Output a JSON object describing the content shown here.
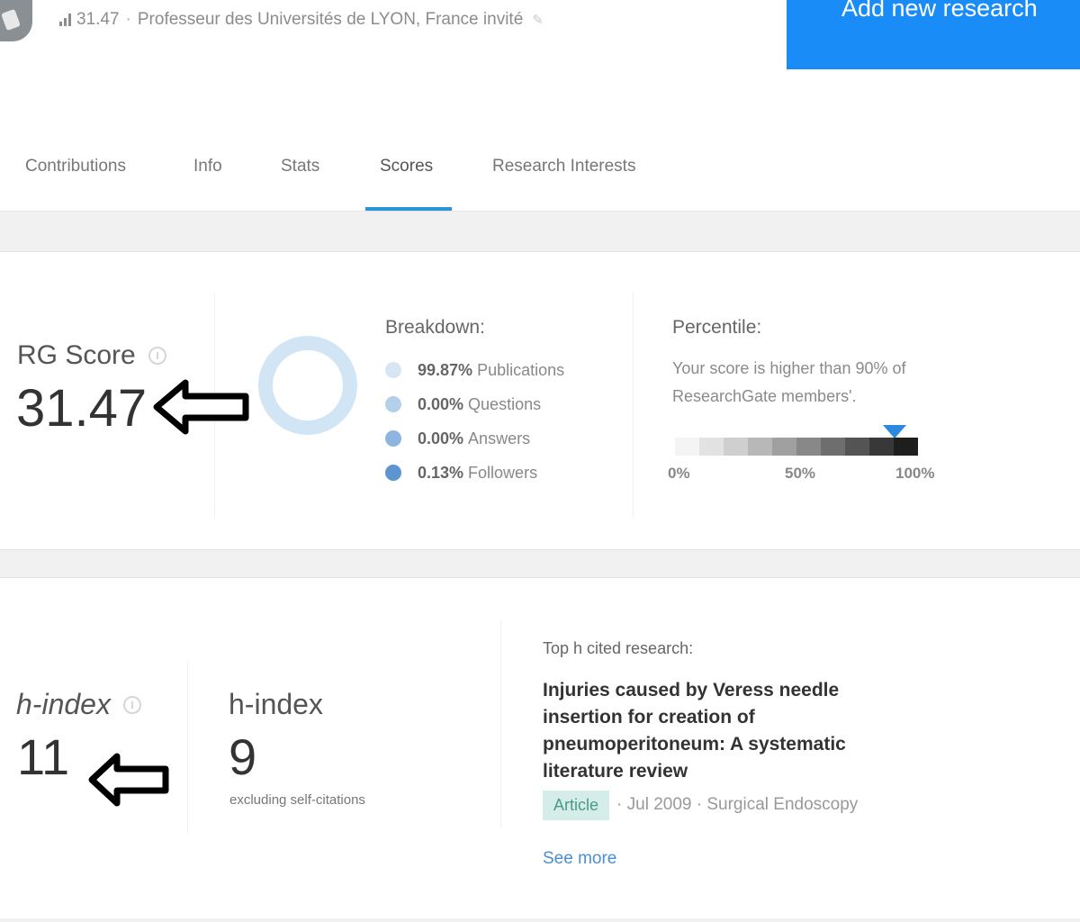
{
  "header": {
    "score": "31.47",
    "separator": "·",
    "subtitle": "Professeur des Universités de LYON, France invité",
    "add_button_label": "Add new research"
  },
  "tabs": [
    {
      "label": "Contributions",
      "active": false
    },
    {
      "label": "Info",
      "active": false
    },
    {
      "label": "Stats",
      "active": false
    },
    {
      "label": "Scores",
      "active": true
    },
    {
      "label": "Research Interests",
      "active": false
    }
  ],
  "rg_score": {
    "title": "RG Score",
    "value": "31.47",
    "breakdown_title": "Breakdown:",
    "breakdown": [
      {
        "pct": "99.87%",
        "label": "Publications",
        "color": "#d8e6f4"
      },
      {
        "pct": "0.00%",
        "label": "Questions",
        "color": "#b4cfe9"
      },
      {
        "pct": "0.00%",
        "label": "Answers",
        "color": "#8db5df"
      },
      {
        "pct": "0.13%",
        "label": "Followers",
        "color": "#5c95d0"
      }
    ],
    "percentile_title": "Percentile:",
    "percentile_text": "Your score is higher than 90% of ResearchGate members'.",
    "percentile_value": 90,
    "percentile_ticks": [
      "0%",
      "50%",
      "100%"
    ]
  },
  "h_index": {
    "title": "h-index",
    "value": "11",
    "excl_title": "h-index",
    "excl_value": "9",
    "excl_caption": "excluding self-citations",
    "top_title": "Top h cited research:",
    "paper_title": "Injuries caused by Veress needle insertion for creation of pneumoperitoneum: A systematic literature review",
    "paper_type": "Article",
    "paper_date": "Jul 2009",
    "paper_journal": "Surgical Endoscopy",
    "meta_separator": "·",
    "see_more": "See more"
  },
  "colors": {
    "accent": "#1a8cf7",
    "tab_underline": "#2b94d8",
    "marker": "#2b8ae0"
  }
}
